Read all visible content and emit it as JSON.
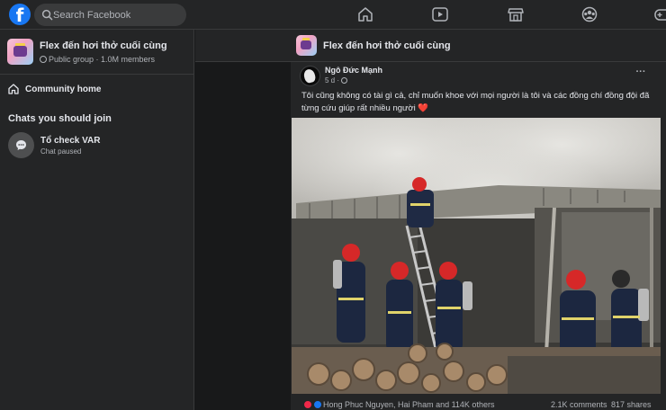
{
  "topbar": {
    "logo": "facebook-f-logo",
    "search_placeholder": "Search Facebook",
    "nav_icons": [
      "home-icon",
      "video-icon",
      "marketplace-icon",
      "groups-icon",
      "gaming-icon"
    ]
  },
  "sidebar": {
    "group_name": "Flex đến hơi thở cuối cùng",
    "group_meta": "Public group · 1.0M members",
    "community_home": "Community home",
    "chats_title": "Chats you should join",
    "chat": {
      "name": "Tổ check VAR",
      "status": "Chat paused"
    }
  },
  "main": {
    "title": "Flex đến hơi thở cuối cùng"
  },
  "post": {
    "author": "Ngô Đức Mạnh",
    "time": "5 d ·",
    "menu": "···",
    "text": "Tôi cũng không có tài gì cả, chỉ muốn khoe với mọi người là  tôi và các đồng chí đồng đội đã từng cứu giúp rất nhiều người",
    "heart": "❤️",
    "reactions": {
      "names": "Hong Phuc Nguyen, Hai Pham and 114K others",
      "comments": "2.1K comments",
      "shares": "817 shares"
    }
  },
  "colors": {
    "background": "#18191a",
    "surface": "#242526",
    "brand": "#1877f2",
    "text_primary": "#e4e6eb",
    "text_secondary": "#b0b3b8"
  }
}
